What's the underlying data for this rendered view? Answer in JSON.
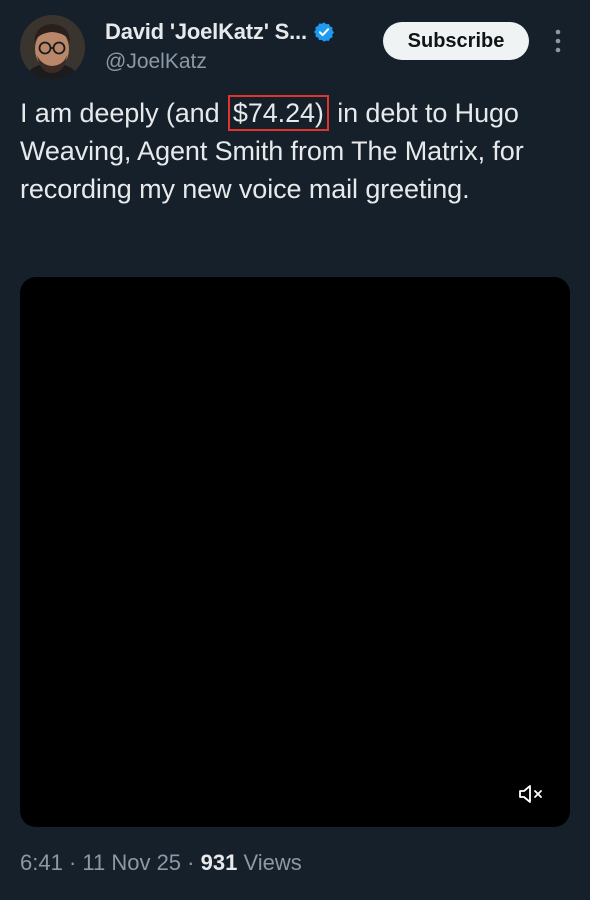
{
  "author": {
    "display_name": "David 'JoelKatz' S...",
    "handle": "@JoelKatz",
    "verified": true,
    "avatar_icon": "profile-photo"
  },
  "actions": {
    "subscribe_label": "Subscribe",
    "more_icon": "vertical-ellipsis-icon"
  },
  "tweet": {
    "text_before": "I am deeply (and ",
    "highlighted": "$74.24)",
    "text_after": " in debt to Hugo Weaving, Agent Smith from The Matrix, for recording my new voice mail greeting.",
    "highlight_color": "#e0352b"
  },
  "media": {
    "type": "video",
    "muted_icon": "muted-speaker-icon"
  },
  "meta": {
    "time": "6:41",
    "sep1": " · ",
    "date": "11 Nov 25",
    "sep2": " · ",
    "views_count": "931",
    "views_label": " Views"
  },
  "colors": {
    "background": "#15202b",
    "text": "#e7e9ea",
    "secondary": "#8b98a5",
    "verified": "#1d9bf0"
  }
}
